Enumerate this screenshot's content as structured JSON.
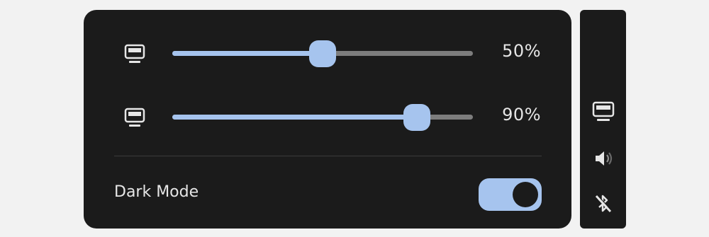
{
  "panel": {
    "sliders": [
      {
        "icon": "monitor-icon",
        "value": 50,
        "label": "50%"
      },
      {
        "icon": "monitor-icon",
        "value": 90,
        "label": "90%"
      }
    ],
    "dark_mode": {
      "label": "Dark Mode",
      "enabled": true
    }
  },
  "sidebar": {
    "icons": [
      "monitor-icon",
      "volume-icon",
      "bluetooth-off-icon"
    ]
  },
  "colors": {
    "accent": "#a6c4ee",
    "panel_bg": "#1b1b1b",
    "text": "#e6e6e6"
  }
}
